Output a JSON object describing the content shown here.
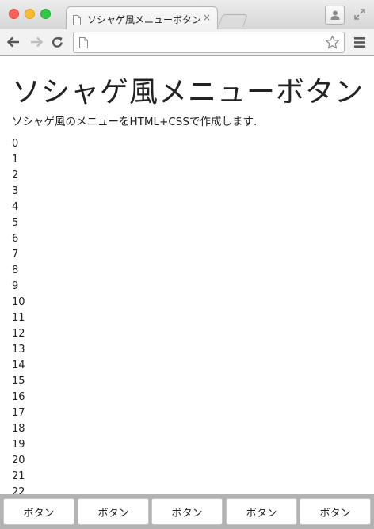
{
  "browser": {
    "tab_title": "ソシャゲ風メニューボタン",
    "tab_close": "×",
    "address_value": ""
  },
  "page": {
    "title": "ソシャゲ風メニューボタン",
    "description": "ソシャゲ風のメニューをHTML+CSSで作成します.",
    "numbers": [
      "0",
      "1",
      "2",
      "3",
      "4",
      "5",
      "6",
      "7",
      "8",
      "9",
      "10",
      "11",
      "12",
      "13",
      "14",
      "15",
      "16",
      "17",
      "18",
      "19",
      "20",
      "21",
      "22"
    ]
  },
  "menu": {
    "buttons": [
      "ボタン",
      "ボタン",
      "ボタン",
      "ボタン",
      "ボタン"
    ]
  }
}
